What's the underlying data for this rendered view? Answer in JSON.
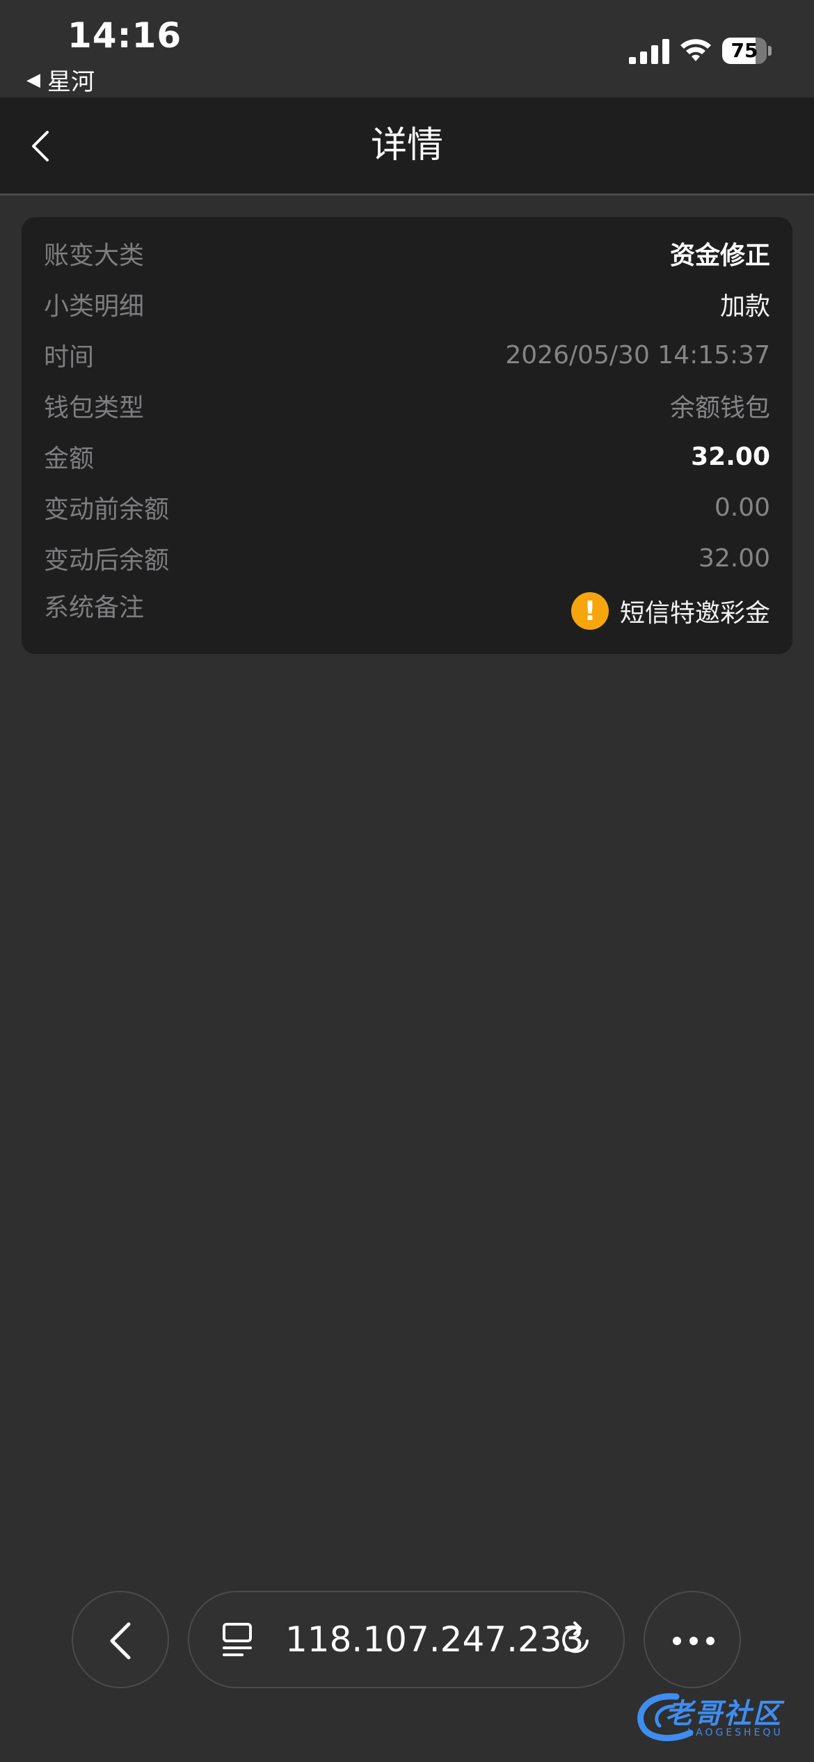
{
  "status_bar": {
    "time": "14:16",
    "back_app": "星河",
    "battery_level": "75",
    "battery_fraction": 0.75
  },
  "header": {
    "title": "详情"
  },
  "details": {
    "rows": [
      {
        "label": "账变大类",
        "value": "资金修正"
      },
      {
        "label": "小类明细",
        "value": "加款"
      },
      {
        "label": "时间",
        "value": "2026/05/30 14:15:37"
      },
      {
        "label": "钱包类型",
        "value": "余额钱包"
      },
      {
        "label": "金额",
        "value": "32.00"
      },
      {
        "label": "变动前余额",
        "value": "0.00"
      },
      {
        "label": "变动后余额",
        "value": "32.00"
      },
      {
        "label": "系统备注",
        "value": "短信特邀彩金"
      }
    ],
    "warning_icon": "!"
  },
  "browser": {
    "url": "118.107.247.233"
  },
  "watermark": {
    "main": "老哥社区",
    "sub": "LAOGESHEQU"
  },
  "colors": {
    "background": "#2f2f30",
    "card": "#1e1e1f",
    "warning": "#f7a50c",
    "watermark": "#3f8df0"
  }
}
